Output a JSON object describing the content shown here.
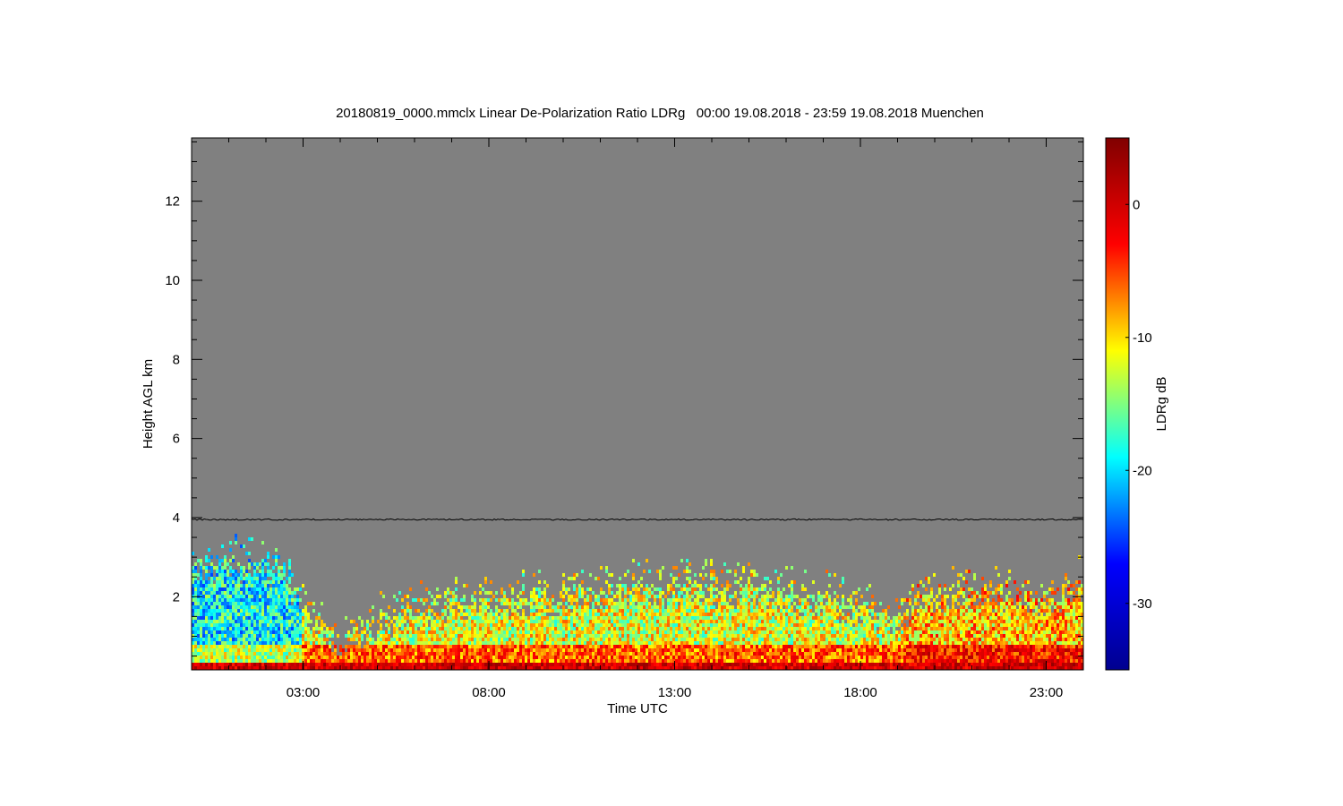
{
  "chart_data": {
    "type": "heatmap",
    "title": "20180819_0000.mmclx Linear De-Polarization Ratio LDRg   00:00 19.08.2018 - 23:59 19.08.2018 Muenchen",
    "xlabel": "Time UTC",
    "ylabel": "Height AGL km",
    "colorbar_label": "LDRg dB",
    "x_unit": "hours UTC",
    "xlim": [
      0,
      24
    ],
    "ylim": [
      0.15,
      13.6
    ],
    "x_ticks": [
      {
        "value": 3,
        "label": "03:00"
      },
      {
        "value": 8,
        "label": "08:00"
      },
      {
        "value": 13,
        "label": "13:00"
      },
      {
        "value": 18,
        "label": "18:00"
      },
      {
        "value": 23,
        "label": "23:00"
      }
    ],
    "y_ticks": [
      {
        "value": 2,
        "label": "2"
      },
      {
        "value": 4,
        "label": "4"
      },
      {
        "value": 6,
        "label": "6"
      },
      {
        "value": 8,
        "label": "8"
      },
      {
        "value": 10,
        "label": "10"
      },
      {
        "value": 12,
        "label": "12"
      }
    ],
    "colorbar_range": [
      -35,
      5
    ],
    "colorbar_ticks": [
      {
        "value": 0,
        "label": "0"
      },
      {
        "value": -10,
        "label": "-10"
      },
      {
        "value": -20,
        "label": "-20"
      },
      {
        "value": -30,
        "label": "-30"
      }
    ],
    "background_color": "#808080",
    "colormap": [
      "#00008f",
      "#0000ff",
      "#00ffff",
      "#ffff00",
      "#ff0000",
      "#800000"
    ],
    "reference_line": {
      "height_km": 3.95,
      "color": "#000000"
    },
    "echo_top_km": [
      {
        "t": 0,
        "top": 3.0
      },
      {
        "t": 1,
        "top": 3.0
      },
      {
        "t": 2.4,
        "top": 2.95
      },
      {
        "t": 3.0,
        "top": 1.8
      },
      {
        "t": 3.6,
        "top": 1.2
      },
      {
        "t": 4.2,
        "top": 1.1
      },
      {
        "t": 5.0,
        "top": 1.5
      },
      {
        "t": 6.0,
        "top": 1.8
      },
      {
        "t": 7.0,
        "top": 2.0
      },
      {
        "t": 9.0,
        "top": 2.1
      },
      {
        "t": 11.0,
        "top": 2.3
      },
      {
        "t": 13.0,
        "top": 2.4
      },
      {
        "t": 15.0,
        "top": 2.4
      },
      {
        "t": 16.5,
        "top": 2.2
      },
      {
        "t": 18.0,
        "top": 1.9
      },
      {
        "t": 19.0,
        "top": 1.6
      },
      {
        "t": 19.5,
        "top": 2.2
      },
      {
        "t": 21.0,
        "top": 2.3
      },
      {
        "t": 23.0,
        "top": 2.1
      },
      {
        "t": 24.0,
        "top": 2.6
      }
    ],
    "regimes": [
      {
        "t_start": 0,
        "t_end": 2.9,
        "ldr_db_typical": -19
      },
      {
        "t_start": 2.9,
        "t_end": 19.1,
        "ldr_db_typical": -12
      },
      {
        "t_start": 19.1,
        "t_end": 24,
        "ldr_db_typical": -9
      }
    ],
    "surface_layer": {
      "top_km": 0.35,
      "ldr_db_typical": 0
    }
  }
}
